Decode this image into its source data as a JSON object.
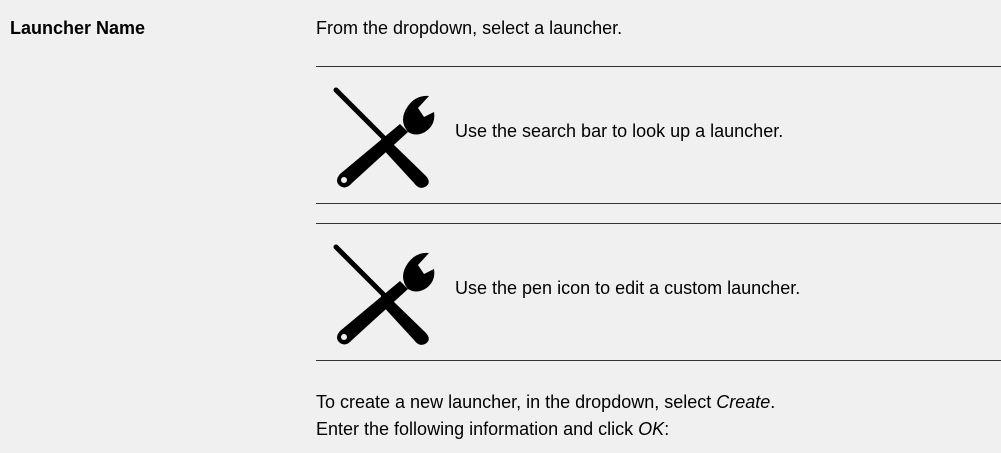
{
  "term": "Launcher Name",
  "intro": "From the dropdown, select a launcher.",
  "notes": [
    {
      "icon": "tools-icon",
      "text": "Use the search bar to look up a launcher."
    },
    {
      "icon": "tools-icon",
      "text": "Use the pen icon to edit a custom launcher."
    }
  ],
  "outro": {
    "line1_prefix": "To create a new launcher, in the dropdown, select ",
    "line1_emph": "Create",
    "line1_suffix": ".",
    "line2_prefix": "Enter the following information and click ",
    "line2_emph": "OK",
    "line2_suffix": ":"
  }
}
